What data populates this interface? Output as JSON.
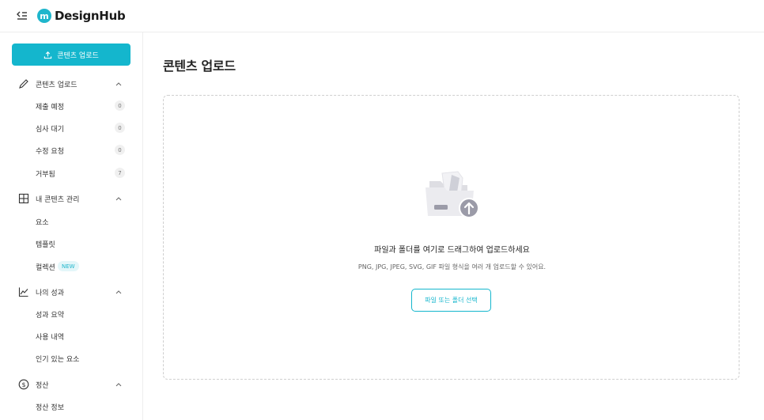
{
  "app": {
    "logo_letter": "m",
    "name": "DesignHub"
  },
  "sidebar": {
    "upload_button": "콘텐츠 업로드",
    "sections": [
      {
        "label": "콘텐츠 업로드",
        "icon": "pencil-icon",
        "items": [
          {
            "label": "제출 예정",
            "count": "0"
          },
          {
            "label": "심사 대기",
            "count": "0"
          },
          {
            "label": "수정 요청",
            "count": "0"
          },
          {
            "label": "거부됨",
            "count": "7"
          }
        ]
      },
      {
        "label": "내 콘텐츠 관리",
        "icon": "grid-icon",
        "items": [
          {
            "label": "요소"
          },
          {
            "label": "템플릿"
          },
          {
            "label": "컬렉션",
            "badge": "NEW"
          }
        ]
      },
      {
        "label": "나의 성과",
        "icon": "chart-line-icon",
        "items": [
          {
            "label": "성과 요약"
          },
          {
            "label": "사용 내역"
          },
          {
            "label": "인기 있는 요소"
          }
        ]
      },
      {
        "label": "정산",
        "icon": "dollar-circle-icon",
        "items": [
          {
            "label": "정산 정보"
          }
        ]
      }
    ]
  },
  "main": {
    "title": "콘텐츠 업로드",
    "dropzone": {
      "title": "파일과 폴더를 여기로 드래그하여 업로드하세요",
      "subtitle": "PNG, JPG, JPEG, SVG, GIF 파일 형식을 여러 개 업로드할 수 있어요.",
      "button": "파일 또는 폴더 선택"
    }
  },
  "colors": {
    "accent": "#14b6cd",
    "border": "#ededed"
  }
}
